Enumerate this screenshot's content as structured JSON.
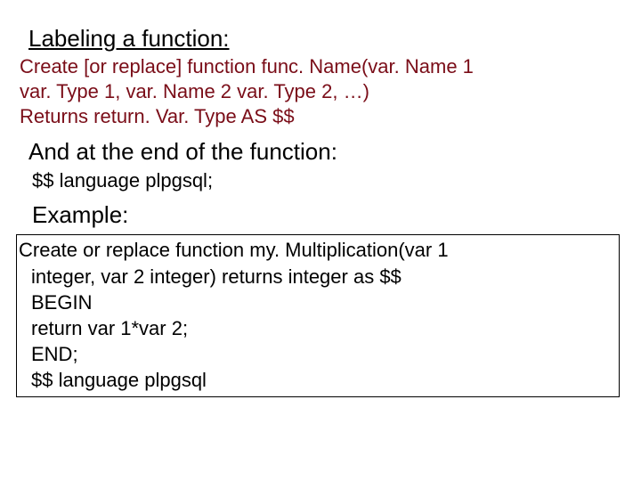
{
  "heading": "Labeling a function:",
  "syntax_lines": {
    "l1": "Create [or replace] function func. Name(var. Name 1",
    "l2": "var. Type 1, var. Name 2 var. Type 2, …)",
    "l3": " Returns return. Var. Type AS $$"
  },
  "subheading": "And at the end of the function:",
  "footer_code": "$$ language plpgsql;",
  "example_label": "Example:",
  "example_lines": {
    "l1": "Create or replace function my. Multiplication(var 1",
    "l2": "integer, var 2 integer) returns integer as $$",
    "l3": "BEGIN",
    "l4": "return var 1*var 2;",
    "l5": "END;",
    "l6": "$$ language plpgsql"
  }
}
